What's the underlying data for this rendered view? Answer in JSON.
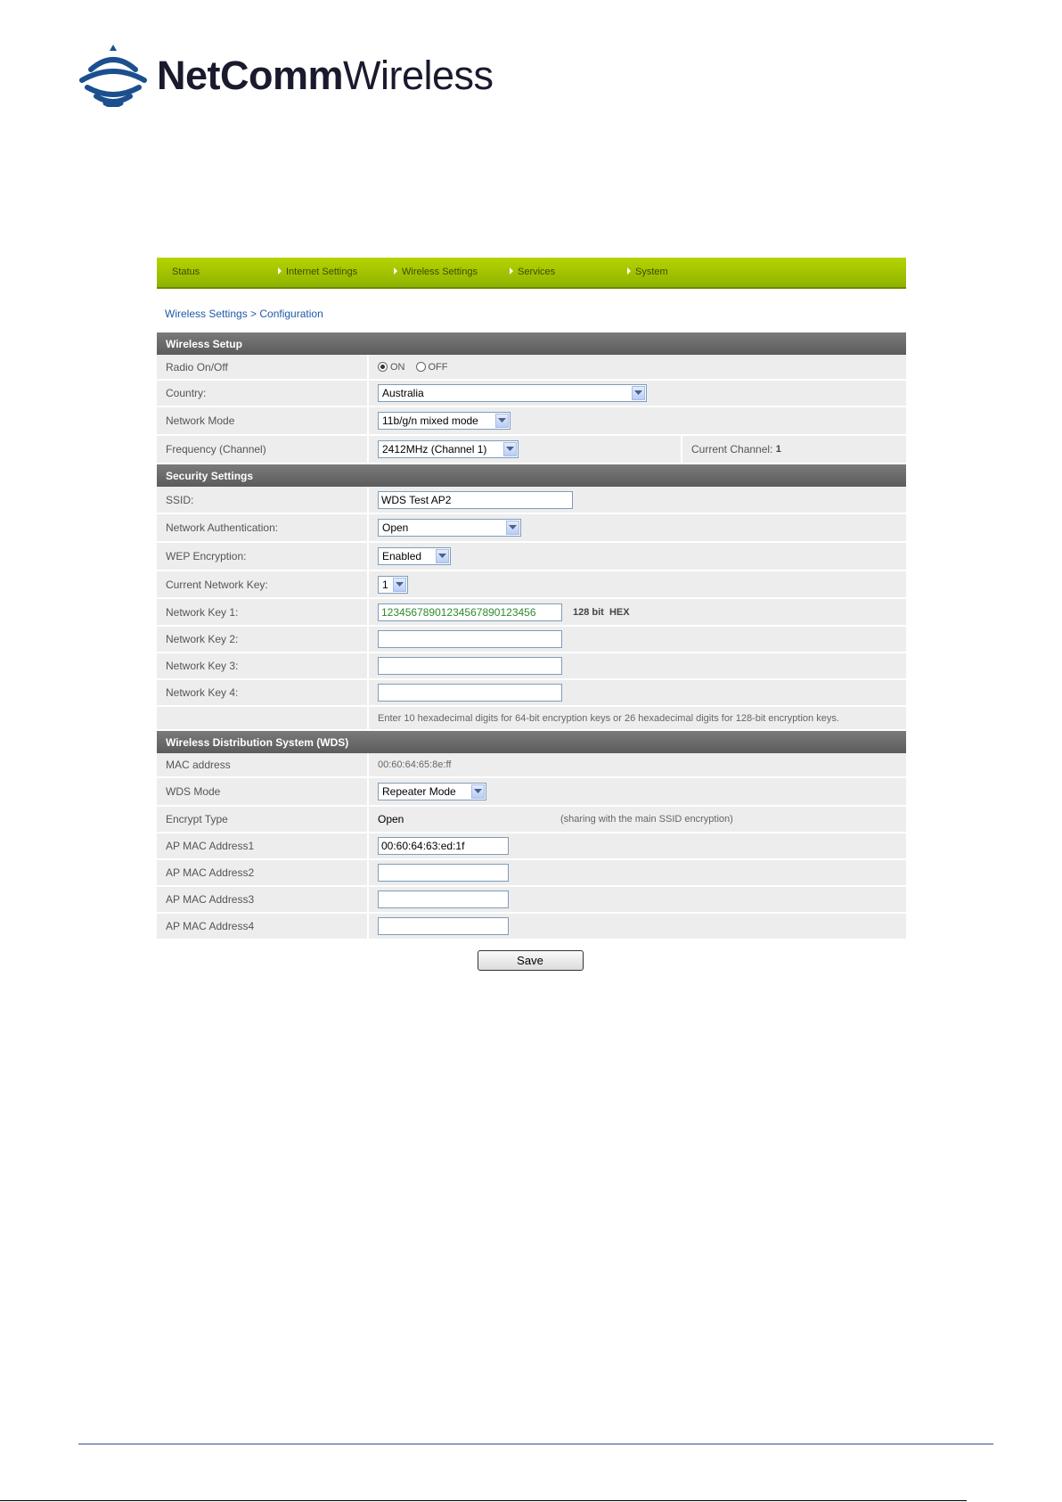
{
  "brand": {
    "name_bold": "NetComm",
    "name_light": "Wireless",
    "logo_color": "#1b4f8f"
  },
  "nav": {
    "items": [
      {
        "label": "Status",
        "arrow": false
      },
      {
        "label": "Internet Settings",
        "arrow": true
      },
      {
        "label": "Wireless Settings",
        "arrow": true
      },
      {
        "label": "Services",
        "arrow": true
      },
      {
        "label": "System",
        "arrow": true
      }
    ],
    "bar_color": "#a4c400"
  },
  "breadcrumb": "Wireless Settings > Configuration",
  "wireless_setup": {
    "title": "Wireless Setup",
    "radio": {
      "label": "Radio On/Off",
      "on_label": "ON",
      "off_label": "OFF",
      "selected": "ON"
    },
    "country": {
      "label": "Country:",
      "value": "Australia"
    },
    "network_mode": {
      "label": "Network Mode",
      "value": "11b/g/n mixed mode"
    },
    "frequency": {
      "label": "Frequency (Channel)",
      "value": "2412MHz (Channel 1)",
      "current_label": "Current Channel:",
      "current_value": "1"
    }
  },
  "security": {
    "title": "Security Settings",
    "ssid": {
      "label": "SSID:",
      "value": "WDS Test AP2"
    },
    "auth": {
      "label": "Network Authentication:",
      "value": "Open"
    },
    "wep": {
      "label": "WEP Encryption:",
      "value": "Enabled"
    },
    "current_key": {
      "label": "Current Network Key:",
      "value": "1"
    },
    "key1": {
      "label": "Network Key 1:",
      "value": "12345678901234567890123456",
      "note": "128 bit  HEX"
    },
    "key2": {
      "label": "Network Key 2:",
      "value": ""
    },
    "key3": {
      "label": "Network Key 3:",
      "value": ""
    },
    "key4": {
      "label": "Network Key 4:",
      "value": ""
    },
    "hint": "Enter 10 hexadecimal digits for 64-bit encryption keys or 26 hexadecimal digits for 128-bit encryption keys."
  },
  "wds": {
    "title": "Wireless Distribution System (WDS)",
    "mac": {
      "label": "MAC address",
      "value": "00:60:64:65:8e:ff"
    },
    "mode": {
      "label": "WDS Mode",
      "value": "Repeater Mode"
    },
    "encrypt": {
      "label": "Encrypt Type",
      "value": "Open",
      "note": "(sharing with the main SSID encryption)"
    },
    "ap1": {
      "label": "AP MAC Address1",
      "value": "00:60:64:63:ed:1f"
    },
    "ap2": {
      "label": "AP MAC Address2",
      "value": ""
    },
    "ap3": {
      "label": "AP MAC Address3",
      "value": ""
    },
    "ap4": {
      "label": "AP MAC Address4",
      "value": ""
    }
  },
  "save_label": "Save"
}
